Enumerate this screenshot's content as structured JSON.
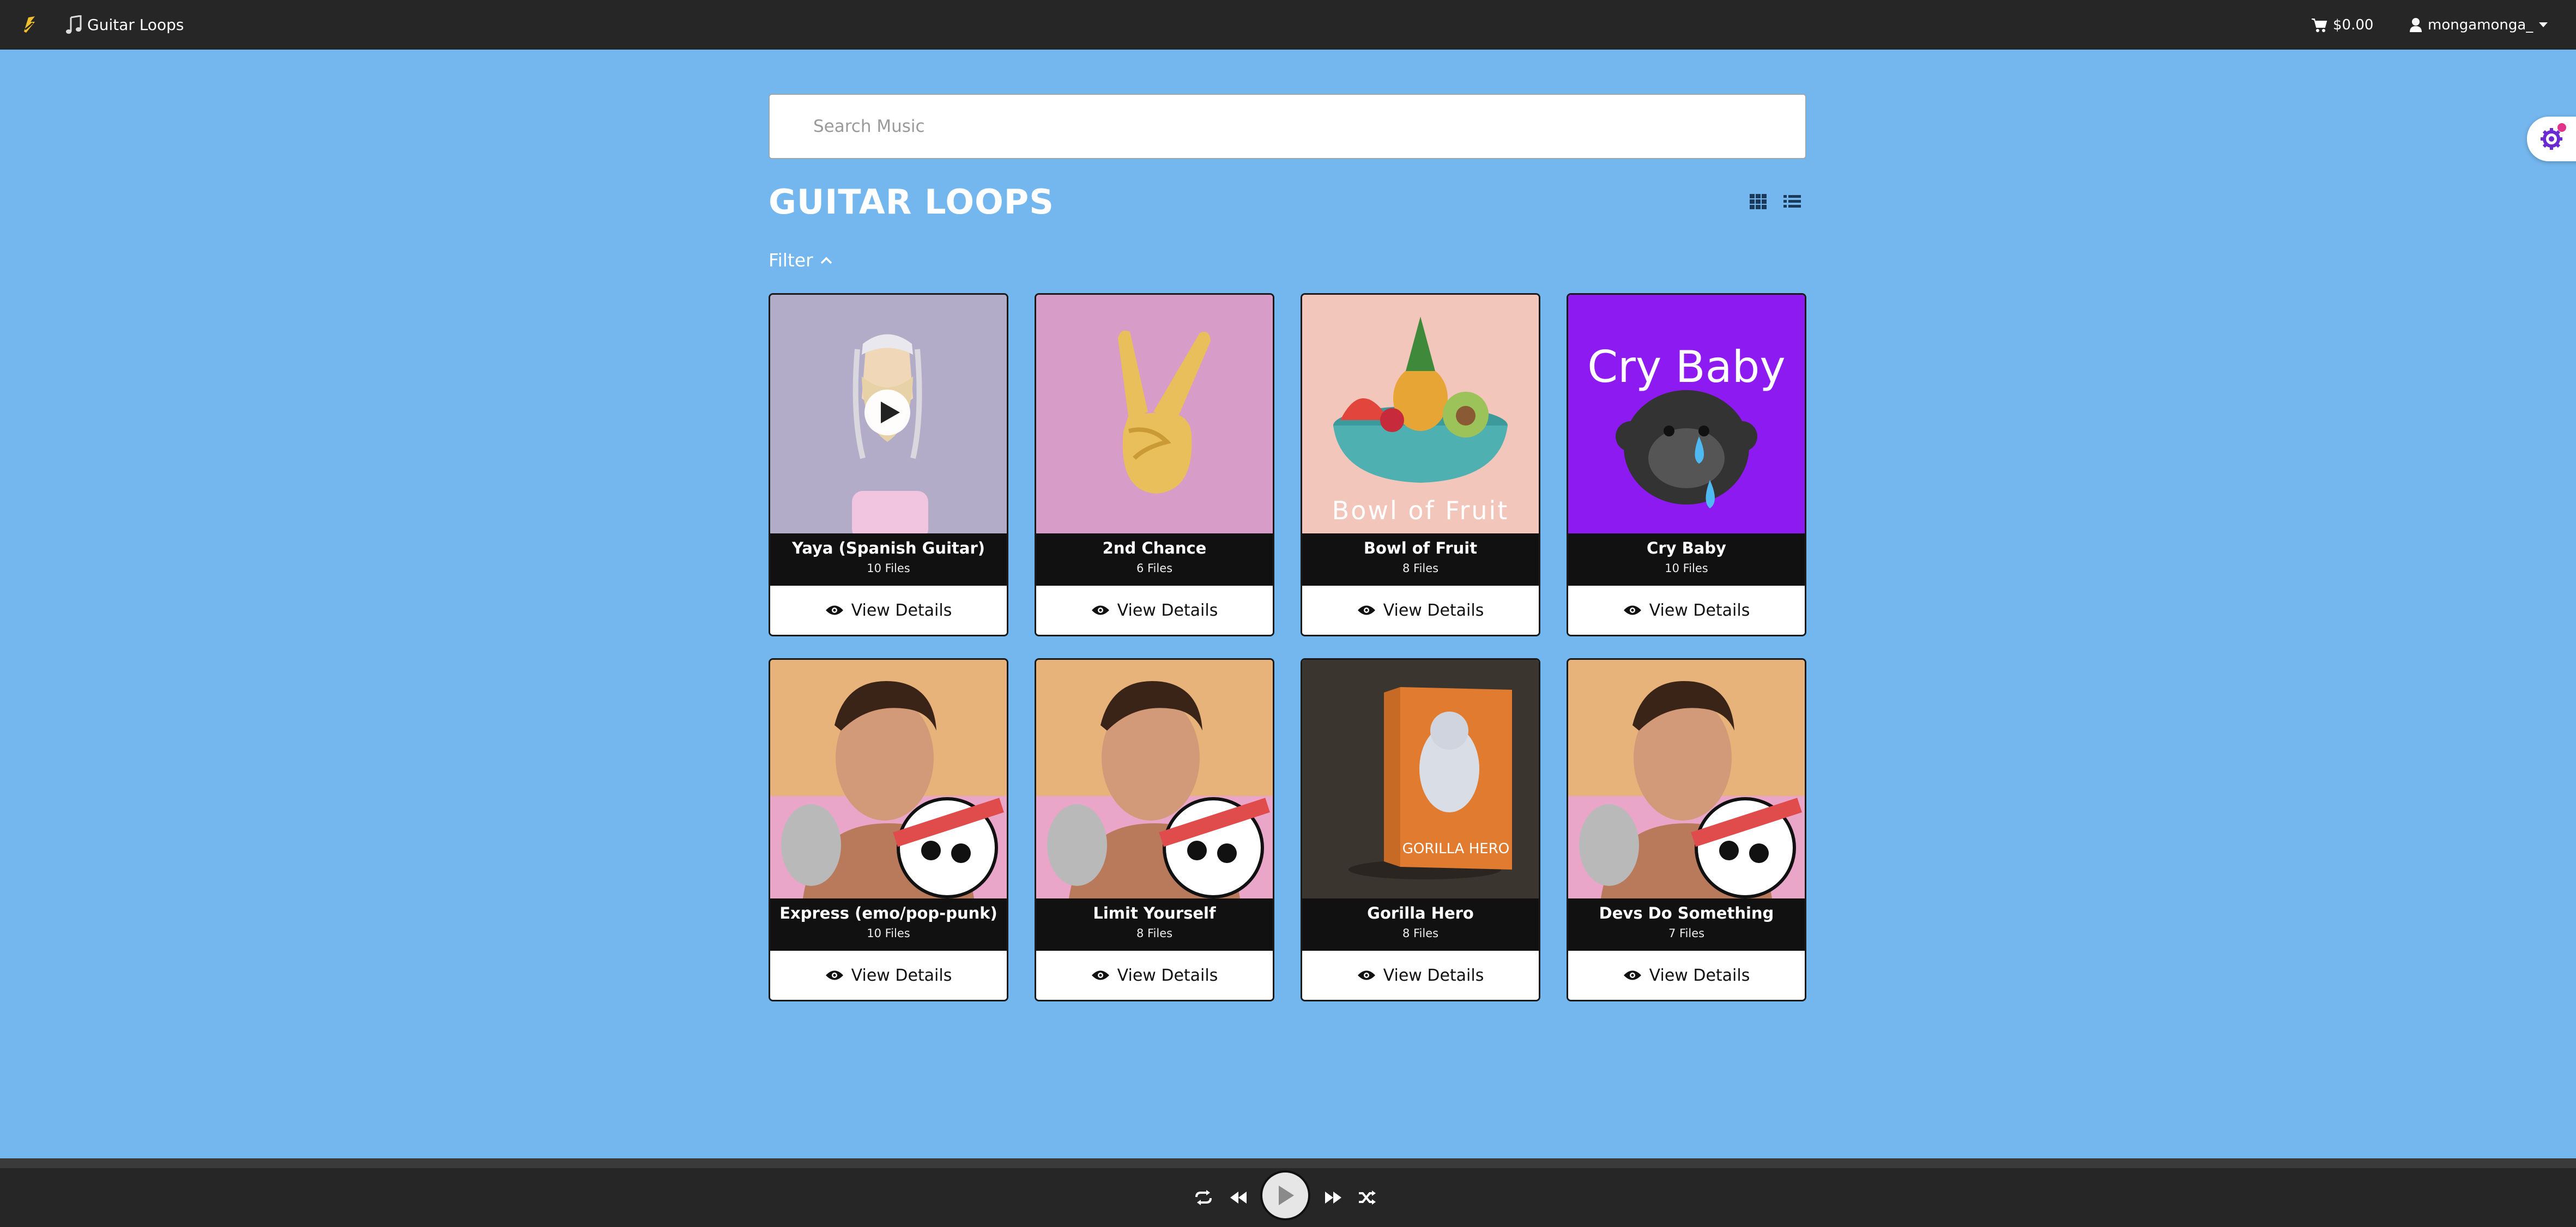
{
  "navbar": {
    "title": "Guitar Loops",
    "cart_total": "$0.00",
    "username": "mongamonga_"
  },
  "search": {
    "placeholder": "Search Music"
  },
  "page": {
    "title": "GUITAR LOOPS",
    "filter_label": "Filter"
  },
  "colors": {
    "background": "#74b7ee",
    "navbar": "#262626",
    "card_meta": "#111111"
  },
  "cards": [
    {
      "name": "Yaya (Spanish Guitar)",
      "files": "10 Files",
      "details_label": "View Details",
      "art": "bearded-cartoon-man"
    },
    {
      "name": "2nd Chance",
      "files": "6 Files",
      "details_label": "View Details",
      "art": "peace-hand"
    },
    {
      "name": "Bowl of Fruit",
      "files": "8 Files",
      "details_label": "View Details",
      "art": "fruit-bowl",
      "art_text": "Bowl of Fruit"
    },
    {
      "name": "Cry Baby",
      "files": "10 Files",
      "details_label": "View Details",
      "art": "crying-gorilla",
      "art_text": "Cry Baby"
    },
    {
      "name": "Express (emo/pop-punk)",
      "files": "10 Files",
      "details_label": "View Details",
      "art": "portrait-skull"
    },
    {
      "name": "Limit Yourself",
      "files": "8 Files",
      "details_label": "View Details",
      "art": "portrait-skull"
    },
    {
      "name": "Gorilla Hero",
      "files": "8 Files",
      "details_label": "View Details",
      "art": "product-box",
      "art_text": "GORILLA HERO"
    },
    {
      "name": "Devs Do Something",
      "files": "7 Files",
      "details_label": "View Details",
      "art": "portrait-skull"
    }
  ],
  "player": {
    "controls": [
      "repeat-icon",
      "rewind-icon",
      "play-icon",
      "fast-forward-icon",
      "shuffle-icon"
    ]
  }
}
